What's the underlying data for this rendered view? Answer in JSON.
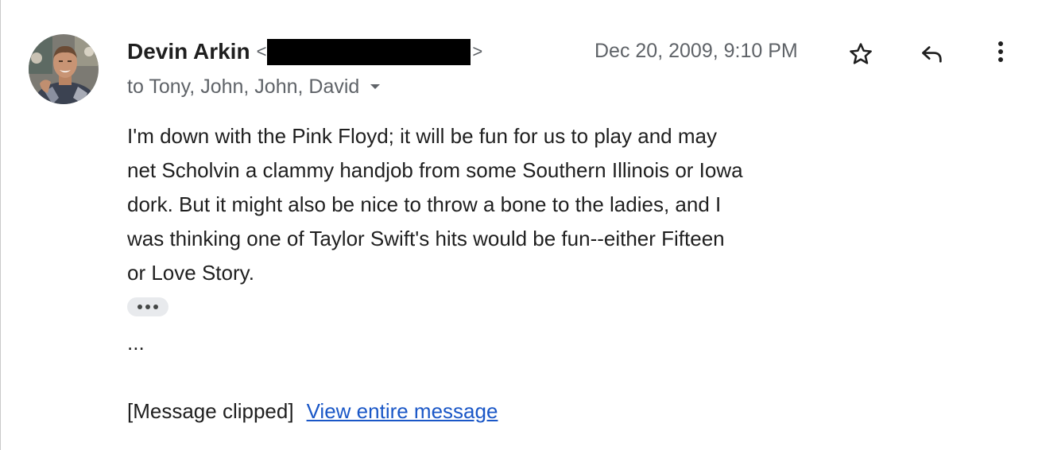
{
  "sender": {
    "name": "Devin Arkin",
    "email_open": "<",
    "email_close": ">"
  },
  "date": "Dec 20, 2009, 9:10 PM",
  "recipients": "to Tony, John, John, David",
  "body": {
    "lines": [
      "I'm down with the Pink Floyd; it will be fun for us to play and may",
      "net Scholvin a clammy handjob from some Southern Illinois or Iowa",
      "dork. But it might also be nice to throw a bone to the ladies, and I",
      "was thinking one of Taylor Swift's hits would be fun--either Fifteen",
      "or Love Story."
    ],
    "ellipsis": "..."
  },
  "clipped": {
    "notice": "[Message clipped]",
    "link": "View entire message"
  },
  "icons": {
    "star": "star-icon",
    "reply": "reply-icon",
    "more": "more-vert-icon",
    "caret": "chevron-down-icon"
  },
  "colors": {
    "text": "#1f1f1f",
    "secondary": "#5f6368",
    "link": "#1a57c7"
  }
}
